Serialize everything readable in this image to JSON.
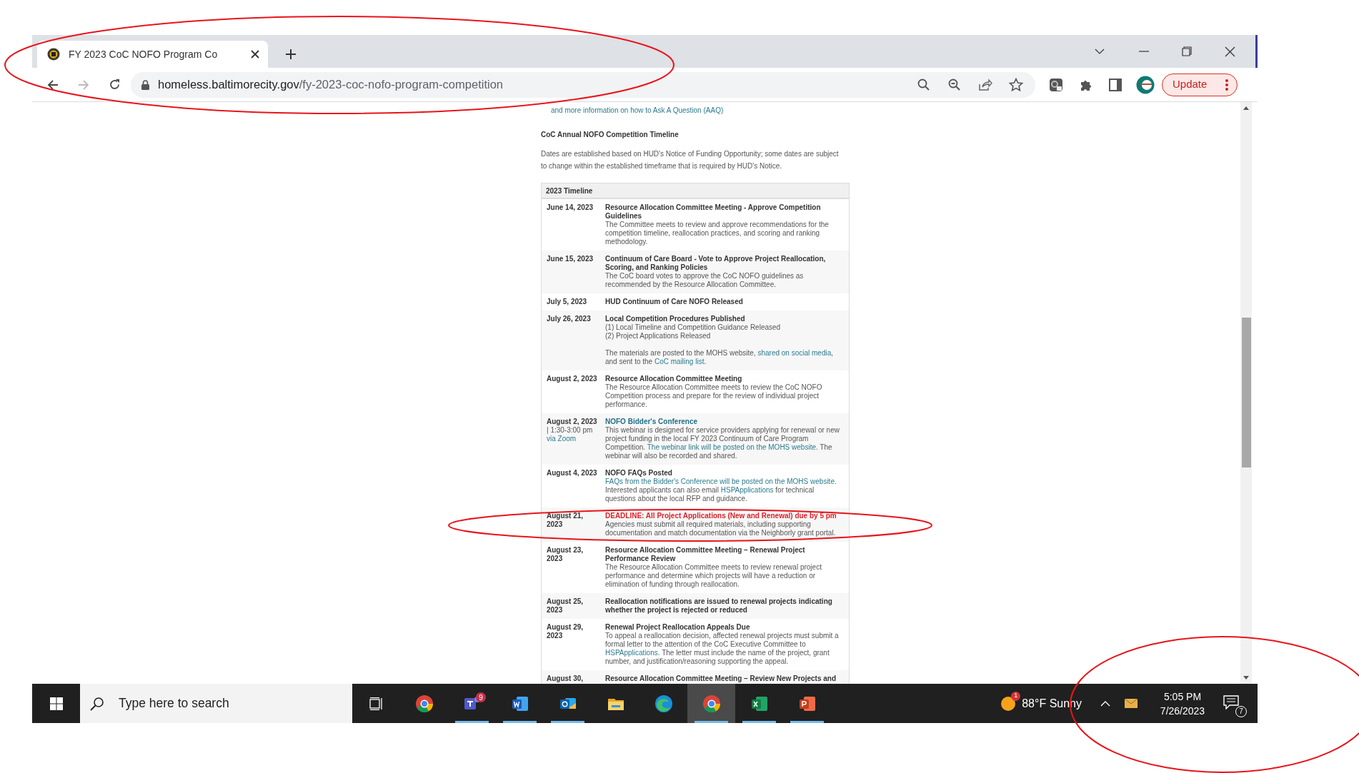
{
  "browser": {
    "tab": {
      "title": "FY 2023 CoC NOFO Program Co",
      "selected": true
    },
    "address": {
      "host": "homeless.baltimorecity.gov",
      "path": "/fy-2023-coc-nofo-program-competition"
    },
    "back_disabled": false,
    "forward_disabled": true,
    "update_button": "Update"
  },
  "page": {
    "top_link": "and more information on how to Ask A Question (AAQ)",
    "heading": "CoC Annual NOFO Competition Timeline",
    "intro": "Dates are established based on HUD's Notice of Funding Opportunity; some dates are subject to change within the established timeframe that is required by HUD's Notice.",
    "table": {
      "header": "2023 Timeline",
      "rows": [
        {
          "date": [
            {
              "text": "June 14, 2023",
              "kind": "bold"
            }
          ],
          "title": "Resource Allocation Committee Meeting - Approve Competition Guidelines",
          "kind": "plain",
          "blocks": [
            [
              [
                {
                  "text": "The Committee meets to review and approve recommendations for the competition timeline, reallocation practices, and scoring and ranking methodology.",
                  "kind": "plain"
                }
              ]
            ]
          ]
        },
        {
          "date": [
            {
              "text": "June 15, 2023",
              "kind": "bold"
            }
          ],
          "title": "Continuum of Care Board - Vote to Approve Project Reallocation, Scoring, and Ranking Policies",
          "kind": "plain",
          "blocks": [
            [
              [
                {
                  "text": "The CoC board votes to approve the CoC NOFO guidelines as recommended by the Resource Allocation Committee.",
                  "kind": "plain"
                }
              ]
            ]
          ]
        },
        {
          "date": [
            {
              "text": "July 5, 2023",
              "kind": "bold"
            }
          ],
          "title": "HUD Continuum of Care NOFO Released",
          "kind": "plain",
          "blocks": []
        },
        {
          "date": [
            {
              "text": "July 26, 2023",
              "kind": "bold"
            }
          ],
          "title": "Local Competition Procedures Published",
          "kind": "plain",
          "blocks": [
            [
              [
                {
                  "text": "(1) Local Timeline and Competition Guidance Released",
                  "kind": "plain"
                }
              ],
              [
                {
                  "text": "(2) Project Applications Released",
                  "kind": "plain"
                }
              ]
            ],
            [
              [
                {
                  "text": "The materials are posted to the MOHS website, ",
                  "kind": "plain"
                },
                {
                  "text": "shared on social media",
                  "kind": "link"
                },
                {
                  "text": ", and sent to the ",
                  "kind": "plain"
                },
                {
                  "text": "CoC mailing list.",
                  "kind": "link"
                }
              ]
            ]
          ]
        },
        {
          "date": [
            {
              "text": "August 2, 2023",
              "kind": "bold"
            }
          ],
          "title": "Resource Allocation Committee Meeting",
          "kind": "plain",
          "blocks": [
            [
              [
                {
                  "text": "The Resource Allocation Committee meets to review the CoC NOFO Competition process and prepare for the review of individual project performance.",
                  "kind": "plain"
                }
              ]
            ]
          ]
        },
        {
          "date": [
            {
              "text": "August 2, 2023",
              "kind": "bold"
            },
            {
              "text": " | 1:30-3:00 pm ",
              "kind": "plain"
            },
            {
              "text": "via Zoom",
              "kind": "link"
            }
          ],
          "title": "NOFO Bidder's Conference",
          "kind": "link",
          "blocks": [
            [
              [
                {
                  "text": "This webinar is designed for service providers applying for renewal or new project funding in the local FY 2023 Continuum of Care Program Competition. ",
                  "kind": "plain"
                },
                {
                  "text": "The webinar link will be posted on the MOHS website.",
                  "kind": "link"
                },
                {
                  "text": " The webinar will also be recorded and shared.",
                  "kind": "plain"
                }
              ]
            ]
          ]
        },
        {
          "date": [
            {
              "text": "August 4, 2023",
              "kind": "bold"
            }
          ],
          "title": "NOFO FAQs Posted",
          "kind": "plain",
          "blocks": [
            [
              [
                {
                  "text": "FAQs from the Bidder's Conference will be posted on the MOHS website.",
                  "kind": "link"
                },
                {
                  "text": " Interested applicants can also email ",
                  "kind": "plain"
                },
                {
                  "text": "HSPApplications",
                  "kind": "link"
                },
                {
                  "text": " for technical questions about the local RFP and guidance.",
                  "kind": "plain"
                }
              ]
            ]
          ]
        },
        {
          "date": [
            {
              "text": "August 21, 2023",
              "kind": "bold"
            }
          ],
          "title": "DEADLINE: All Project Applications (New and Renewal) due by 5 pm",
          "kind": "alert",
          "blocks": [
            [
              [
                {
                  "text": "Agencies must submit all required materials, including supporting documentation and match documentation via the Neighborly grant portal.",
                  "kind": "plain"
                }
              ]
            ]
          ]
        },
        {
          "date": [
            {
              "text": "August 23, 2023",
              "kind": "bold"
            }
          ],
          "title": "Resource Allocation Committee Meeting – Renewal Project Performance Review",
          "kind": "plain",
          "blocks": [
            [
              [
                {
                  "text": "The Resource Allocation Committee meets to review renewal project performance and determine which projects will have a reduction or elimination of funding through reallocation.",
                  "kind": "plain"
                }
              ]
            ]
          ]
        },
        {
          "date": [
            {
              "text": "August 25, 2023",
              "kind": "bold"
            }
          ],
          "title": "Reallocation notifications are issued to renewal projects indicating whether the project is rejected or reduced",
          "kind": "plain",
          "blocks": []
        },
        {
          "date": [
            {
              "text": "August 29, 2023",
              "kind": "bold"
            }
          ],
          "title": "Renewal Project Reallocation Appeals Due",
          "kind": "plain",
          "blocks": [
            [
              [
                {
                  "text": "To appeal a reallocation decision, affected renewal projects must submit a formal letter to the attention of the CoC Executive Committee to ",
                  "kind": "plain"
                },
                {
                  "text": "HSPApplications.",
                  "kind": "link"
                },
                {
                  "text": " The letter must include the name of the project, grant number, and justification/reasoning supporting the appeal.",
                  "kind": "plain"
                }
              ]
            ]
          ]
        },
        {
          "date": [
            {
              "text": "August 30,",
              "kind": "bold"
            }
          ],
          "title": "Resource Allocation Committee Meeting – Review New Projects and",
          "kind": "plain",
          "blocks": []
        }
      ]
    }
  },
  "taskbar": {
    "search_placeholder": "Type here to search",
    "apps": [
      {
        "kind": "chrome",
        "running": false,
        "selected": false
      },
      {
        "kind": "teams",
        "running": true,
        "selected": false,
        "badge": "9"
      },
      {
        "kind": "word",
        "running": true,
        "selected": false
      },
      {
        "kind": "outlook",
        "running": true,
        "selected": false
      },
      {
        "kind": "explorer",
        "running": false,
        "selected": false
      },
      {
        "kind": "edge",
        "running": false,
        "selected": false
      },
      {
        "kind": "chrome",
        "running": true,
        "selected": true
      },
      {
        "kind": "excel",
        "running": true,
        "selected": false
      },
      {
        "kind": "powerpoint",
        "running": true,
        "selected": false
      }
    ],
    "weather": {
      "badge": "1",
      "text": "88°F Sunny"
    },
    "clock": {
      "time": "5:05 PM",
      "date": "7/26/2023"
    },
    "notifications": "7"
  }
}
